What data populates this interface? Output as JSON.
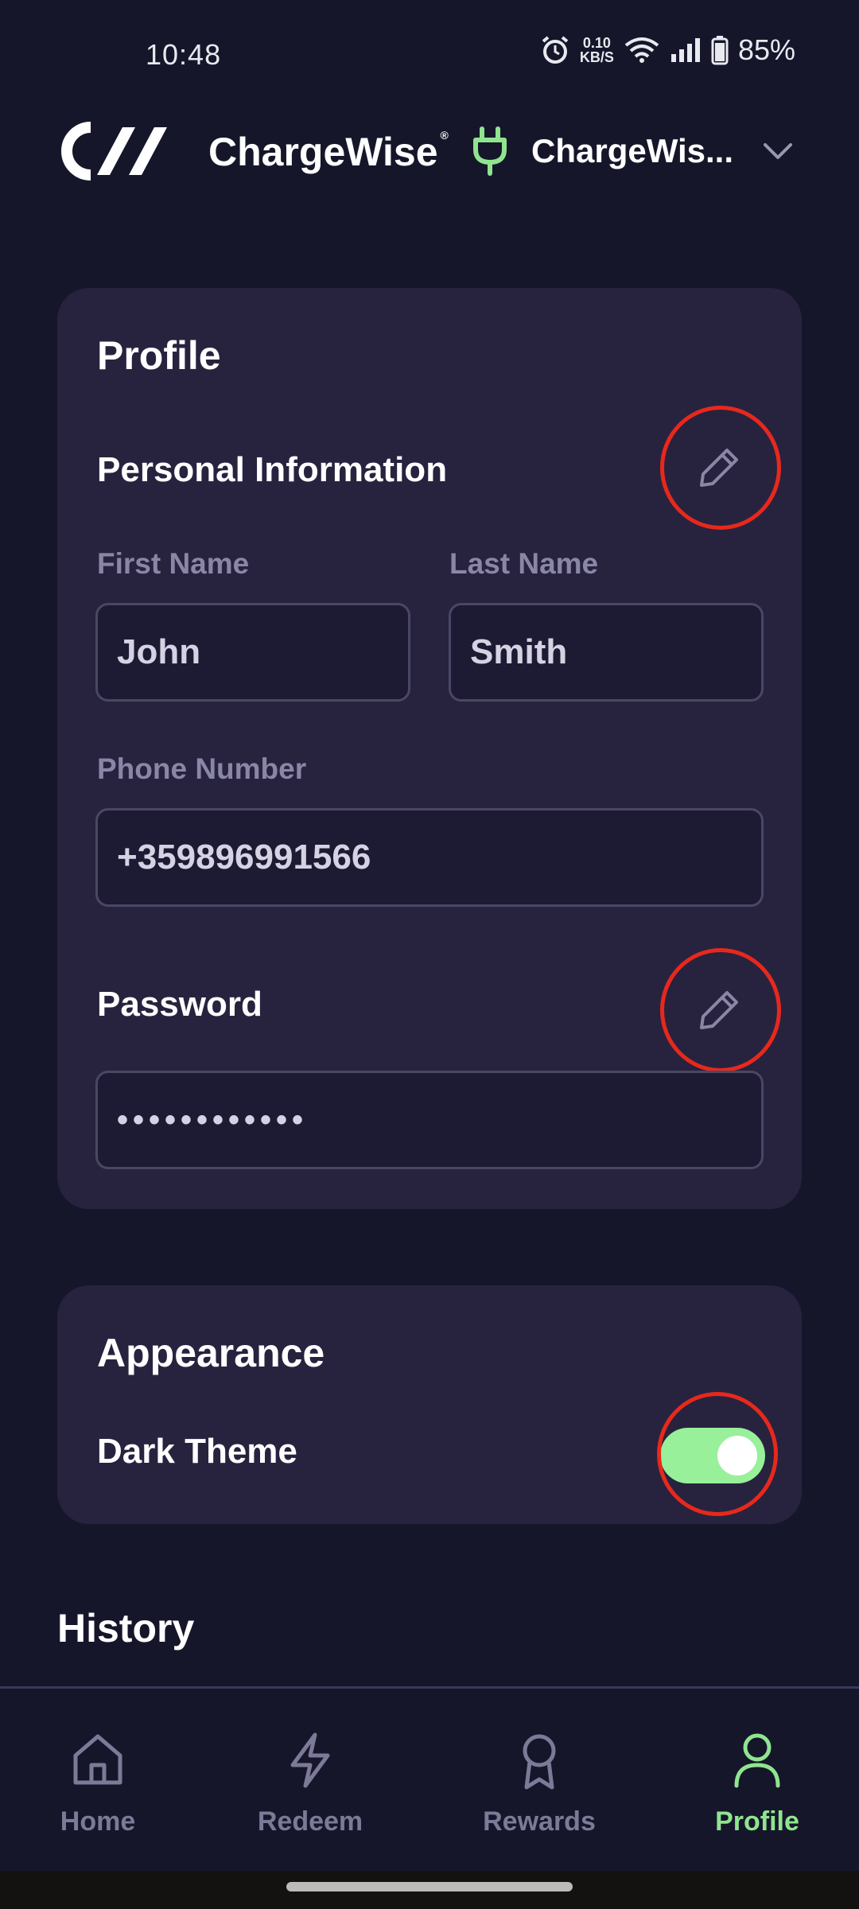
{
  "status_bar": {
    "time": "10:48",
    "net_speed_value": "0.10",
    "net_speed_unit": "KB/S",
    "battery": "85%",
    "icons": [
      "alarm-icon",
      "wifi-icon",
      "signal-icon",
      "battery-icon"
    ]
  },
  "header": {
    "brand": "ChargeWise",
    "brand_mark": "®",
    "station_name": "ChargeWis...",
    "icons": [
      "logo-icon",
      "plug-icon",
      "chevron-down-icon"
    ]
  },
  "profile": {
    "title": "Profile",
    "personal_info": {
      "title": "Personal Information",
      "first_name_label": "First Name",
      "first_name_value": "John",
      "last_name_label": "Last Name",
      "last_name_value": "Smith",
      "phone_label": "Phone Number",
      "phone_value": "+359896991566"
    },
    "password": {
      "title": "Password",
      "value": "••••••••••••"
    }
  },
  "appearance": {
    "title": "Appearance",
    "dark_theme_label": "Dark Theme",
    "dark_theme_on": true
  },
  "history": {
    "title": "History"
  },
  "nav": {
    "items": [
      {
        "label": "Home",
        "icon": "home-icon",
        "active": false
      },
      {
        "label": "Redeem",
        "icon": "lightning-icon",
        "active": false
      },
      {
        "label": "Rewards",
        "icon": "ribbon-icon",
        "active": false
      },
      {
        "label": "Profile",
        "icon": "person-icon",
        "active": true
      }
    ]
  },
  "colors": {
    "background": "#16162b",
    "card": "#27233f",
    "accent_green": "#98f09a",
    "highlight_red": "#e8281c",
    "muted_text": "#8a86a6"
  }
}
